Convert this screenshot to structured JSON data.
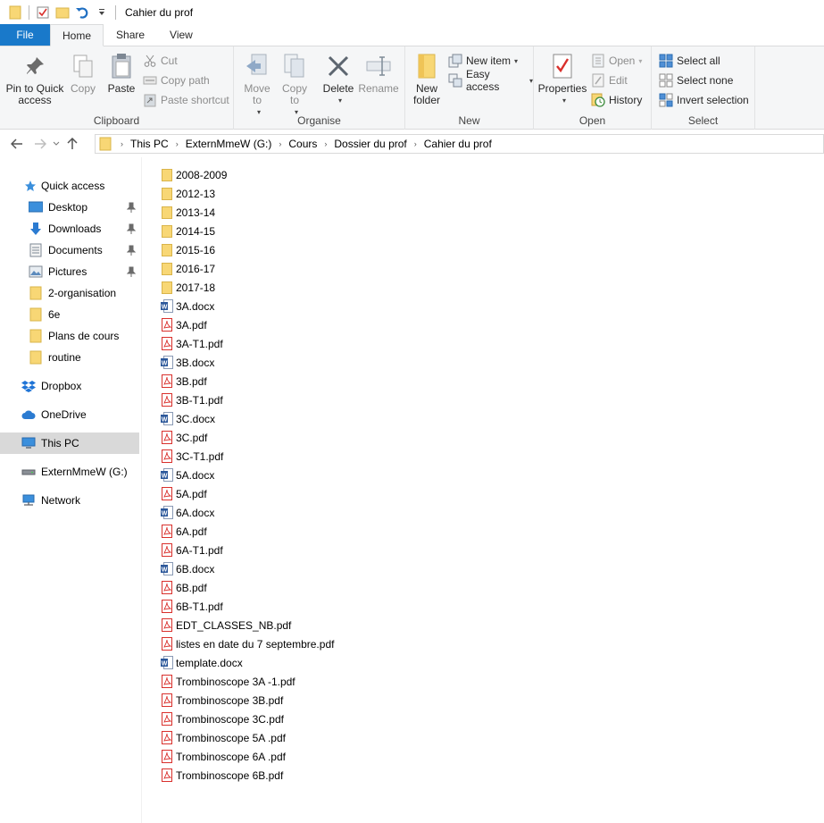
{
  "window": {
    "title": "Cahier du prof"
  },
  "tabs": [
    {
      "label": "File"
    },
    {
      "label": "Home"
    },
    {
      "label": "Share"
    },
    {
      "label": "View"
    }
  ],
  "ribbon": {
    "clipboard": {
      "label": "Clipboard",
      "pin": "Pin to Quick access",
      "copy": "Copy",
      "paste": "Paste",
      "cut": "Cut",
      "copy_path": "Copy path",
      "paste_shortcut": "Paste shortcut"
    },
    "organise": {
      "label": "Organise",
      "move_to": "Move to",
      "copy_to": "Copy to",
      "delete": "Delete",
      "rename": "Rename"
    },
    "new": {
      "label": "New",
      "new_folder": "New folder",
      "new_item": "New item",
      "easy_access": "Easy access"
    },
    "open": {
      "label": "Open",
      "properties": "Properties",
      "open": "Open",
      "edit": "Edit",
      "history": "History"
    },
    "select": {
      "label": "Select",
      "select_all": "Select all",
      "select_none": "Select none",
      "invert_selection": "Invert selection"
    }
  },
  "address": {
    "crumbs": [
      "This PC",
      "ExternMmeW (G:)",
      "Cours",
      "Dossier du prof",
      "Cahier du prof"
    ]
  },
  "nav": {
    "quick_access": "Quick access",
    "desktop": "Desktop",
    "downloads": "Downloads",
    "documents": "Documents",
    "pictures": "Pictures",
    "organisation": "2-organisation",
    "sixe": "6e",
    "plans": "Plans de cours",
    "routine": "routine",
    "dropbox": "Dropbox",
    "onedrive": "OneDrive",
    "thispc": "This PC",
    "extern": "ExternMmeW (G:)",
    "network": "Network"
  },
  "files": [
    {
      "name": "2008-2009",
      "type": "folder"
    },
    {
      "name": "2012-13",
      "type": "folder"
    },
    {
      "name": "2013-14",
      "type": "folder"
    },
    {
      "name": "2014-15",
      "type": "folder"
    },
    {
      "name": "2015-16",
      "type": "folder"
    },
    {
      "name": "2016-17",
      "type": "folder"
    },
    {
      "name": "2017-18",
      "type": "folder"
    },
    {
      "name": "3A.docx",
      "type": "docx"
    },
    {
      "name": "3A.pdf",
      "type": "pdf"
    },
    {
      "name": "3A-T1.pdf",
      "type": "pdf"
    },
    {
      "name": "3B.docx",
      "type": "docx"
    },
    {
      "name": "3B.pdf",
      "type": "pdf"
    },
    {
      "name": "3B-T1.pdf",
      "type": "pdf"
    },
    {
      "name": "3C.docx",
      "type": "docx"
    },
    {
      "name": "3C.pdf",
      "type": "pdf"
    },
    {
      "name": "3C-T1.pdf",
      "type": "pdf"
    },
    {
      "name": "5A.docx",
      "type": "docx"
    },
    {
      "name": "5A.pdf",
      "type": "pdf"
    },
    {
      "name": "6A.docx",
      "type": "docx"
    },
    {
      "name": "6A.pdf",
      "type": "pdf"
    },
    {
      "name": "6A-T1.pdf",
      "type": "pdf"
    },
    {
      "name": "6B.docx",
      "type": "docx"
    },
    {
      "name": "6B.pdf",
      "type": "pdf"
    },
    {
      "name": "6B-T1.pdf",
      "type": "pdf"
    },
    {
      "name": "EDT_CLASSES_NB.pdf",
      "type": "pdf"
    },
    {
      "name": "listes en date du 7 septembre.pdf",
      "type": "pdf"
    },
    {
      "name": "template.docx",
      "type": "docx"
    },
    {
      "name": "Trombinoscope 3A -1.pdf",
      "type": "pdf"
    },
    {
      "name": "Trombinoscope 3B.pdf",
      "type": "pdf"
    },
    {
      "name": "Trombinoscope 3C.pdf",
      "type": "pdf"
    },
    {
      "name": "Trombinoscope 5A .pdf",
      "type": "pdf"
    },
    {
      "name": "Trombinoscope 6A .pdf",
      "type": "pdf"
    },
    {
      "name": "Trombinoscope 6B.pdf",
      "type": "pdf"
    }
  ],
  "colors": {
    "file_tab": "#1979ca",
    "folder": "#f8d775",
    "pdf": "#d9302c",
    "word": "#2b579a",
    "selected": "#d9d9d9"
  }
}
